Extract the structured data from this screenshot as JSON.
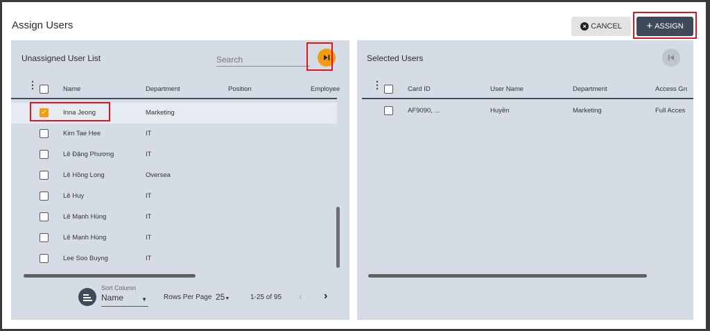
{
  "dialog": {
    "title": "Assign Users",
    "cancel_label": "CANCEL",
    "assign_label": "ASSIGN",
    "assign_prefix": "+"
  },
  "left_panel": {
    "title": "Unassigned User List",
    "search_placeholder": "Search",
    "columns": [
      "Name",
      "Department",
      "Position",
      "Employee N"
    ],
    "rows": [
      {
        "name": "Inna Jeong",
        "department": "Marketing",
        "checked": true
      },
      {
        "name": "Kim Tae Hee",
        "department": "IT",
        "checked": false
      },
      {
        "name": "Lê Đặng Phương",
        "department": "IT",
        "checked": false
      },
      {
        "name": "Lê Hồng Long",
        "department": "Oversea",
        "checked": false
      },
      {
        "name": "Lê Huy",
        "department": "IT",
        "checked": false
      },
      {
        "name": "Lê Mạnh Hùng",
        "department": "IT",
        "checked": false
      },
      {
        "name": "Lê Mạnh Hùng",
        "department": "IT",
        "checked": false
      },
      {
        "name": "Lee Soo Buyng",
        "department": "IT",
        "checked": false
      }
    ],
    "pager": {
      "sort_column_label": "Sort Column",
      "sort_value": "Name",
      "rows_per_page_label": "Rows Per Page",
      "rows_per_page_value": "25",
      "range": "1-25 of 95"
    }
  },
  "right_panel": {
    "title": "Selected Users",
    "columns": [
      "Card ID",
      "User Name",
      "Department",
      "Access Gro"
    ],
    "rows": [
      {
        "card_id": "AF9090, ...",
        "user_name": "Huyền",
        "department": "Marketing",
        "access_group": "Full Acces"
      }
    ]
  },
  "colors": {
    "accent_orange": "#f39c12",
    "dark_button": "#3f4a59",
    "highlight_red": "#e0141d",
    "panel_bg": "#d5dce6"
  },
  "icons": [
    "cancel-x-icon",
    "plus-icon",
    "skip-forward-icon",
    "skip-back-icon",
    "kebab-menu-icon",
    "sort-icon",
    "chevron-left-icon",
    "chevron-right-icon",
    "dropdown-caret-icon"
  ]
}
